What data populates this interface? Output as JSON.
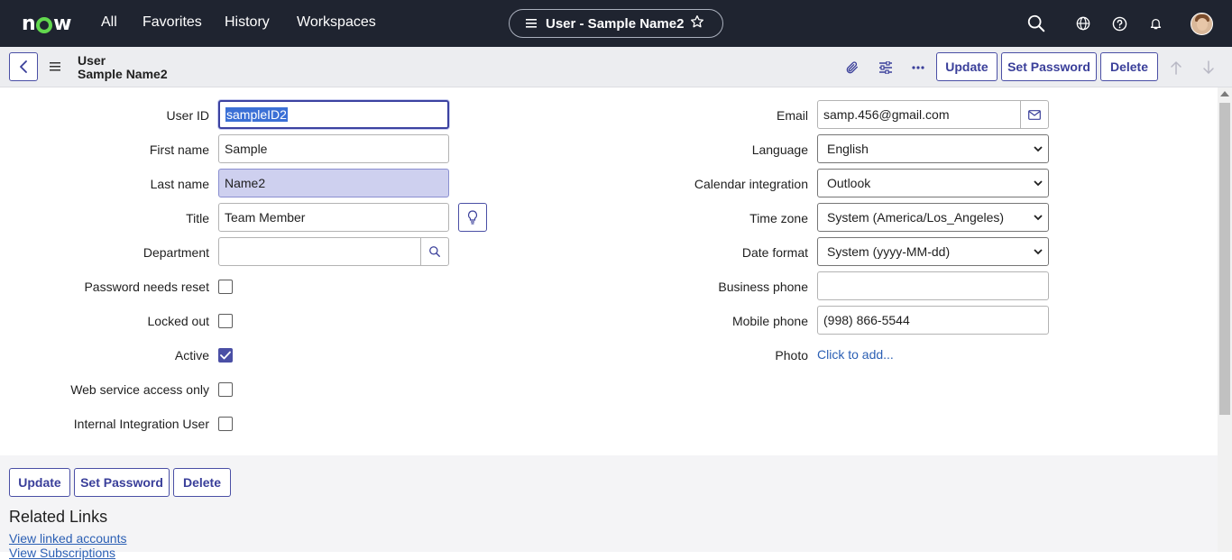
{
  "topnav": {
    "logo": "now",
    "items": [
      "All",
      "Favorites",
      "History",
      "Workspaces"
    ],
    "context_title": "User - Sample Name2",
    "icons": [
      "search-icon",
      "globe-icon",
      "help-icon",
      "bell-icon"
    ]
  },
  "header": {
    "record_type": "User",
    "record_name": "Sample Name2",
    "buttons": {
      "update": "Update",
      "set_password": "Set Password",
      "delete": "Delete"
    },
    "icons": [
      "paperclip-icon",
      "sliders-icon",
      "more-icon",
      "arrow-up-icon",
      "arrow-down-icon"
    ]
  },
  "form": {
    "left": {
      "user_id": {
        "label": "User ID",
        "value": "sampleID2"
      },
      "first_name": {
        "label": "First name",
        "value": "Sample"
      },
      "last_name": {
        "label": "Last name",
        "value": "Name2"
      },
      "title": {
        "label": "Title",
        "value": "Team Member"
      },
      "department": {
        "label": "Department",
        "value": ""
      },
      "password_needs_reset": {
        "label": "Password needs reset",
        "checked": false
      },
      "locked_out": {
        "label": "Locked out",
        "checked": false
      },
      "active": {
        "label": "Active",
        "checked": true
      },
      "web_service_access_only": {
        "label": "Web service access only",
        "checked": false
      },
      "internal_integration_user": {
        "label": "Internal Integration User",
        "checked": false
      }
    },
    "right": {
      "email": {
        "label": "Email",
        "value": "samp.456@gmail.com"
      },
      "language": {
        "label": "Language",
        "value": "English"
      },
      "calendar_integration": {
        "label": "Calendar integration",
        "value": "Outlook"
      },
      "time_zone": {
        "label": "Time zone",
        "value": "System (America/Los_Angeles)"
      },
      "date_format": {
        "label": "Date format",
        "value": "System (yyyy-MM-dd)"
      },
      "business_phone": {
        "label": "Business phone",
        "value": ""
      },
      "mobile_phone": {
        "label": "Mobile phone",
        "value": "(998) 866-5544"
      },
      "photo": {
        "label": "Photo",
        "link": "Click to add..."
      }
    }
  },
  "footer": {
    "buttons": {
      "update": "Update",
      "set_password": "Set Password",
      "delete": "Delete"
    },
    "related_links_title": "Related Links",
    "related_links": [
      "View linked accounts",
      "View Subscriptions"
    ]
  },
  "colors": {
    "nav_bg": "#1f2430",
    "accent": "#4a4fa5",
    "link": "#2b5fb4",
    "highlight_field": "#ced0ef",
    "logo_green": "#62d84e"
  }
}
